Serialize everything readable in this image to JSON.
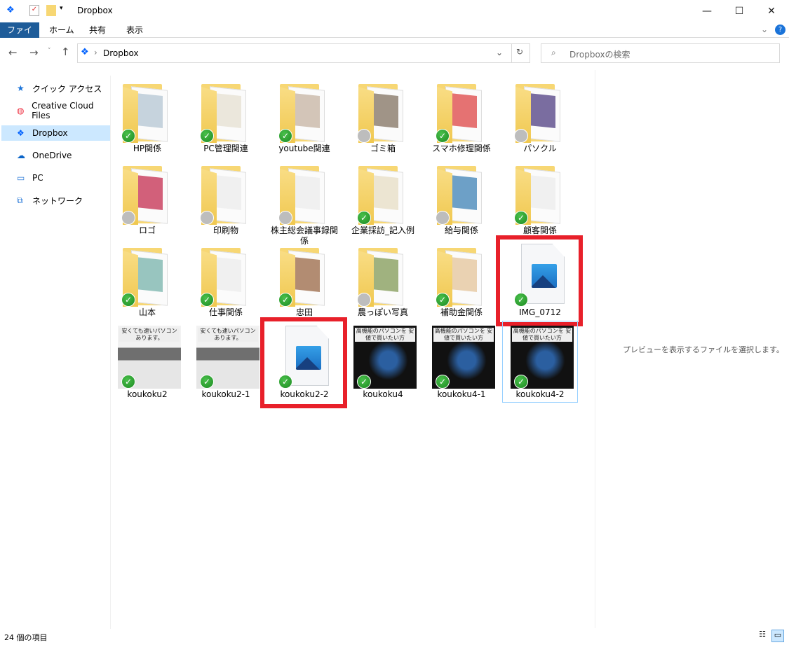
{
  "window": {
    "title": "Dropbox",
    "minimize": "—",
    "maximize": "☐",
    "close": "✕"
  },
  "ribbon": {
    "tabs": [
      "ファイル",
      "ホーム",
      "共有",
      "表示"
    ],
    "help": "?"
  },
  "address": {
    "path": "Dropbox",
    "search_placeholder": "Dropboxの検索"
  },
  "nav": [
    {
      "label": "クイック アクセス",
      "icon": "star-icon"
    },
    {
      "label": "Creative Cloud Files",
      "icon": "creative-cloud-icon"
    },
    {
      "label": "Dropbox",
      "icon": "dropbox-icon",
      "selected": true
    },
    {
      "label": "OneDrive",
      "icon": "onedrive-icon"
    },
    {
      "label": "PC",
      "icon": "pc-icon"
    },
    {
      "label": "ネットワーク",
      "icon": "network-icon"
    }
  ],
  "items": [
    {
      "name": "HP関係",
      "type": "folder",
      "status": "synced"
    },
    {
      "name": "PC管理関連",
      "type": "folder",
      "status": "synced"
    },
    {
      "name": "youtube関連",
      "type": "folder",
      "status": "synced"
    },
    {
      "name": "ゴミ箱",
      "type": "folder",
      "status": "online"
    },
    {
      "name": "スマホ修理関係",
      "type": "folder",
      "status": "synced"
    },
    {
      "name": "パソクル",
      "type": "folder",
      "status": "online"
    },
    {
      "name": "ロゴ",
      "type": "folder",
      "status": "online"
    },
    {
      "name": "印刷物",
      "type": "folder",
      "status": "online"
    },
    {
      "name": "株主総会議事録関係",
      "type": "folder",
      "status": "online"
    },
    {
      "name": "企業採訪_記入例",
      "type": "folder",
      "status": "synced"
    },
    {
      "name": "給与関係",
      "type": "folder",
      "status": "online"
    },
    {
      "name": "顧客関係",
      "type": "folder",
      "status": "synced"
    },
    {
      "name": "山本",
      "type": "folder",
      "status": "synced"
    },
    {
      "name": "仕事関係",
      "type": "folder",
      "status": "synced"
    },
    {
      "name": "忠田",
      "type": "folder",
      "status": "synced"
    },
    {
      "name": "農っぽい写真",
      "type": "folder",
      "status": "online"
    },
    {
      "name": "補助金関係",
      "type": "folder",
      "status": "synced"
    },
    {
      "name": "IMG_0712",
      "type": "image",
      "status": "synced",
      "highlighted": true
    },
    {
      "name": "koukoku2",
      "type": "photo-light",
      "status": "synced",
      "caption": "安くても速いパソコン あります。"
    },
    {
      "name": "koukoku2-1",
      "type": "photo-light",
      "status": "synced",
      "caption": "安くても速いパソコン あります。"
    },
    {
      "name": "koukoku2-2",
      "type": "image",
      "status": "synced",
      "highlighted": true
    },
    {
      "name": "koukoku4",
      "type": "photo-dark",
      "status": "synced",
      "caption": "高機能のパソコンを 安値で買いたい方"
    },
    {
      "name": "koukoku4-1",
      "type": "photo-dark",
      "status": "synced",
      "caption": "高機能のパソコンを 安値で買いたい方"
    },
    {
      "name": "koukoku4-2",
      "type": "photo-dark",
      "status": "synced",
      "caption": "高機能のパソコンを 安値で買いたい方",
      "selected": true
    }
  ],
  "preview": {
    "message": "プレビューを表示するファイルを選択します。"
  },
  "statusbar": {
    "count": "24 個の項目"
  },
  "colors": {
    "accent": "#1e5c99",
    "highlight": "#e8202a",
    "selected": "#cce8ff"
  }
}
